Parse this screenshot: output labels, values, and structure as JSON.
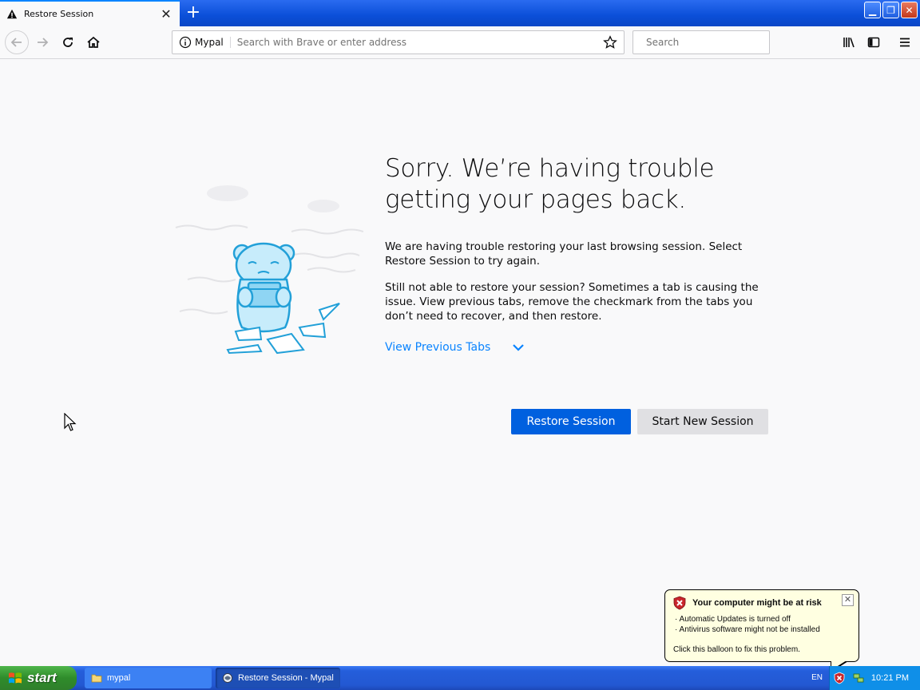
{
  "browser": {
    "tab_title": "Restore Session",
    "new_tab_label": "+",
    "identity_label": "Mypal",
    "address_placeholder": "Search with Brave or enter address",
    "search_placeholder": "Search"
  },
  "content": {
    "heading_line1": "Sorry. We’re having trouble",
    "heading_line2": "getting your pages back.",
    "paragraph1": "We are having trouble restoring your last browsing session. Select Restore Session to try again.",
    "paragraph2": "Still not able to restore your session? Sometimes a tab is causing the issue. View previous tabs, remove the checkmark from the tabs you don’t need to recover, and then restore.",
    "view_previous_tabs": "View Previous Tabs",
    "restore_button": "Restore Session",
    "new_session_button": "Start New Session"
  },
  "balloon": {
    "title": "Your computer might be at risk",
    "line1": "· Automatic Updates is turned off",
    "line2": "· Antivirus software might not be installed",
    "fix": "Click this balloon to fix this problem."
  },
  "taskbar": {
    "start_label": "start",
    "task1": "mypal",
    "task2": "Restore Session - Mypal",
    "language": "EN",
    "clock": "10:21 PM"
  },
  "colors": {
    "accent": "#0060df",
    "link": "#0a84ff",
    "taskbar": "#245edb",
    "start_green": "#3c9a37"
  }
}
